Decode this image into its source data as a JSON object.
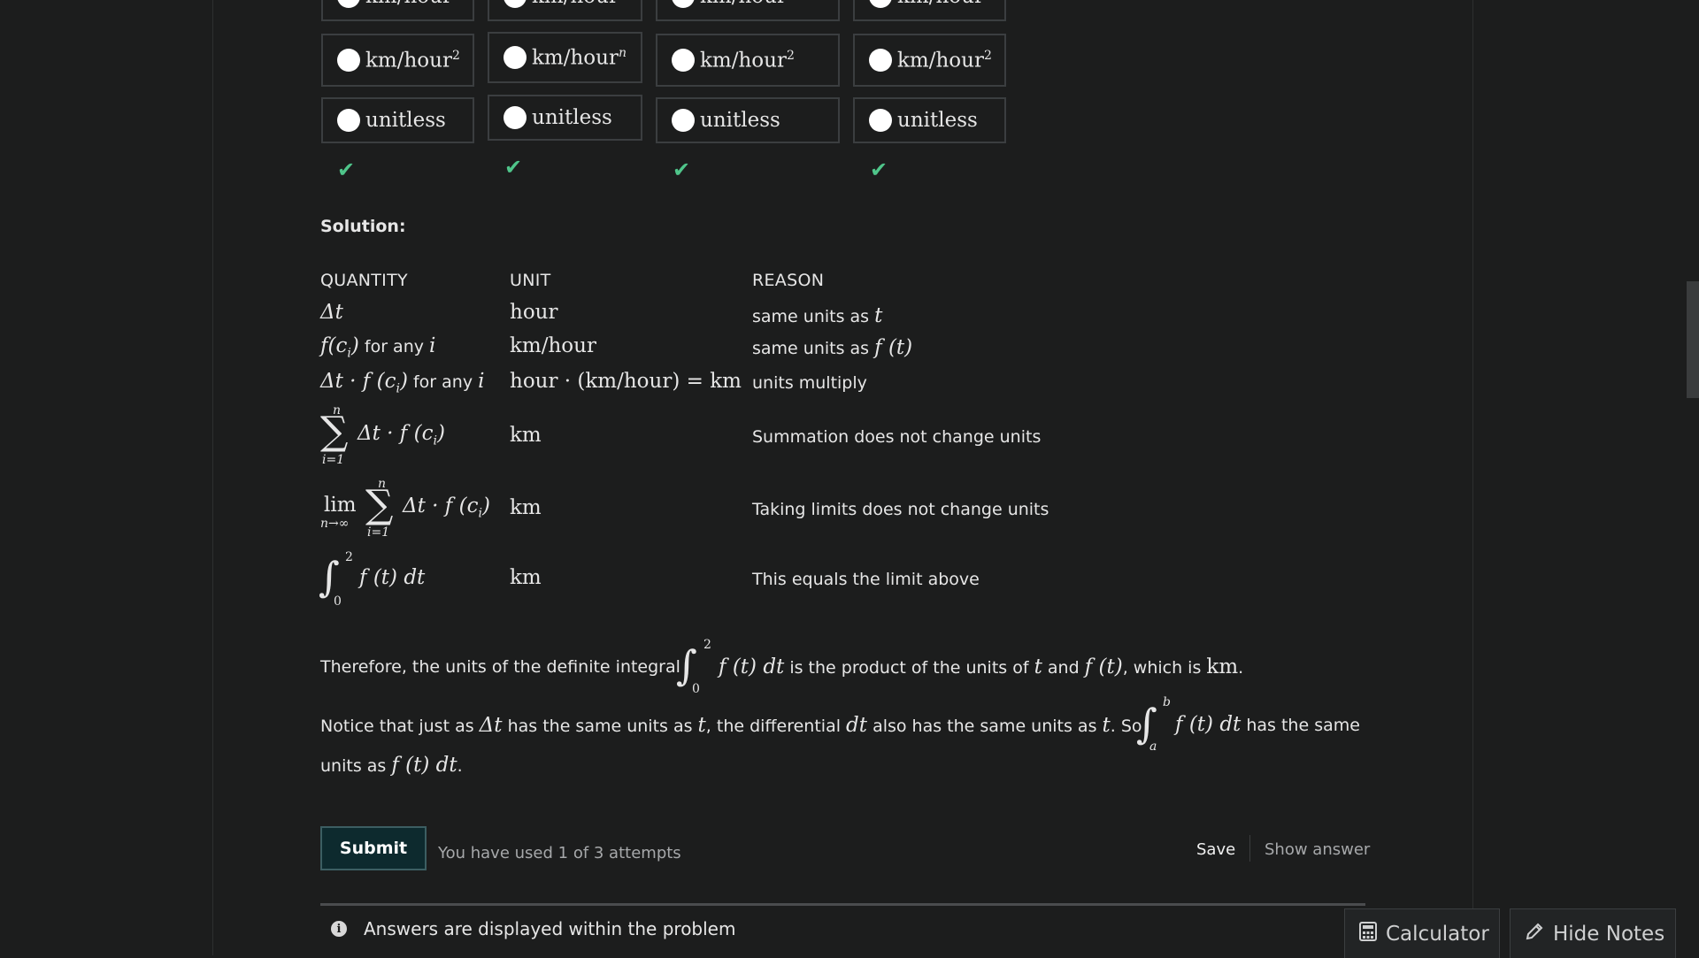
{
  "options": {
    "row_top": [
      "km/hour",
      "km/hour",
      "km/hour",
      "km/hour"
    ],
    "row2_base": "km/hour",
    "row2_sup": [
      "2",
      "n",
      "2",
      "2"
    ],
    "row3": [
      "unitless",
      "unitless",
      "unitless",
      "unitless"
    ],
    "check_glyph": "✔"
  },
  "solution": {
    "heading": "Solution:",
    "columns": {
      "quantity": "QUANTITY",
      "unit": "UNIT",
      "reason": "REASON"
    },
    "rows": [
      {
        "quantity": "Δt",
        "unit": "hour",
        "reason": "same units as",
        "reason_math": "t"
      },
      {
        "quantity": "f(c",
        "quantity_sub": "i",
        "quantity_close": ")",
        "quantity_text": "for any",
        "quantity_var": "i",
        "unit": "km/hour",
        "reason": "same units as",
        "reason_math": "f (t)"
      },
      {
        "quantity": "Δt · f (c",
        "quantity_sub": "i",
        "quantity_close": ")",
        "quantity_text": "for any",
        "quantity_var": "i",
        "unit": "hour · (km/hour) = km",
        "reason": "units multiply"
      },
      {
        "sum_upper": "n",
        "sum_lower": "i=1",
        "quantity": "Δt · f (c",
        "quantity_sub": "i",
        "quantity_close": ")",
        "unit": "km",
        "reason": "Summation does not change units"
      },
      {
        "lim": "lim",
        "lim_sub": "n→∞",
        "sum_upper": "n",
        "sum_lower": "i=1",
        "quantity": "Δt · f (c",
        "quantity_sub": "i",
        "quantity_close": ")",
        "unit": "km",
        "reason": "Taking limits does not change units"
      },
      {
        "int_upper": "2",
        "int_lower": "0",
        "quantity": "f (t)  dt",
        "unit": "km",
        "reason": "This equals the limit above"
      }
    ],
    "para1": {
      "a": "Therefore, the units of the definite integral",
      "int_upper": "2",
      "int_lower": "0",
      "expr": "f (t)  dt",
      "b": "is the product of the units of",
      "t": "t",
      "c": "and",
      "ft": "f (t)",
      "d": ", which is",
      "km": "km",
      "e": "."
    },
    "para2": {
      "a": "Notice that just as",
      "dt": "Δt",
      "b": "has the same units as",
      "t1": "t",
      "c": ", the differential",
      "d_dt": "dt",
      "d": "also has the same units as",
      "t2": "t",
      "e": ". So",
      "int_upper": "b",
      "int_lower": "a",
      "expr": "f (t)  dt",
      "f": "has the same",
      "g": "units as",
      "expr2": "f (t) dt",
      "h": "."
    }
  },
  "actions": {
    "submit": "Submit",
    "attempts": "You have used 1 of 3 attempts",
    "save": "Save",
    "show_answer": "Show answer"
  },
  "footer": {
    "info": "Answers are displayed within the problem",
    "calculator": "Calculator",
    "hide_notes": "Hide Notes"
  }
}
